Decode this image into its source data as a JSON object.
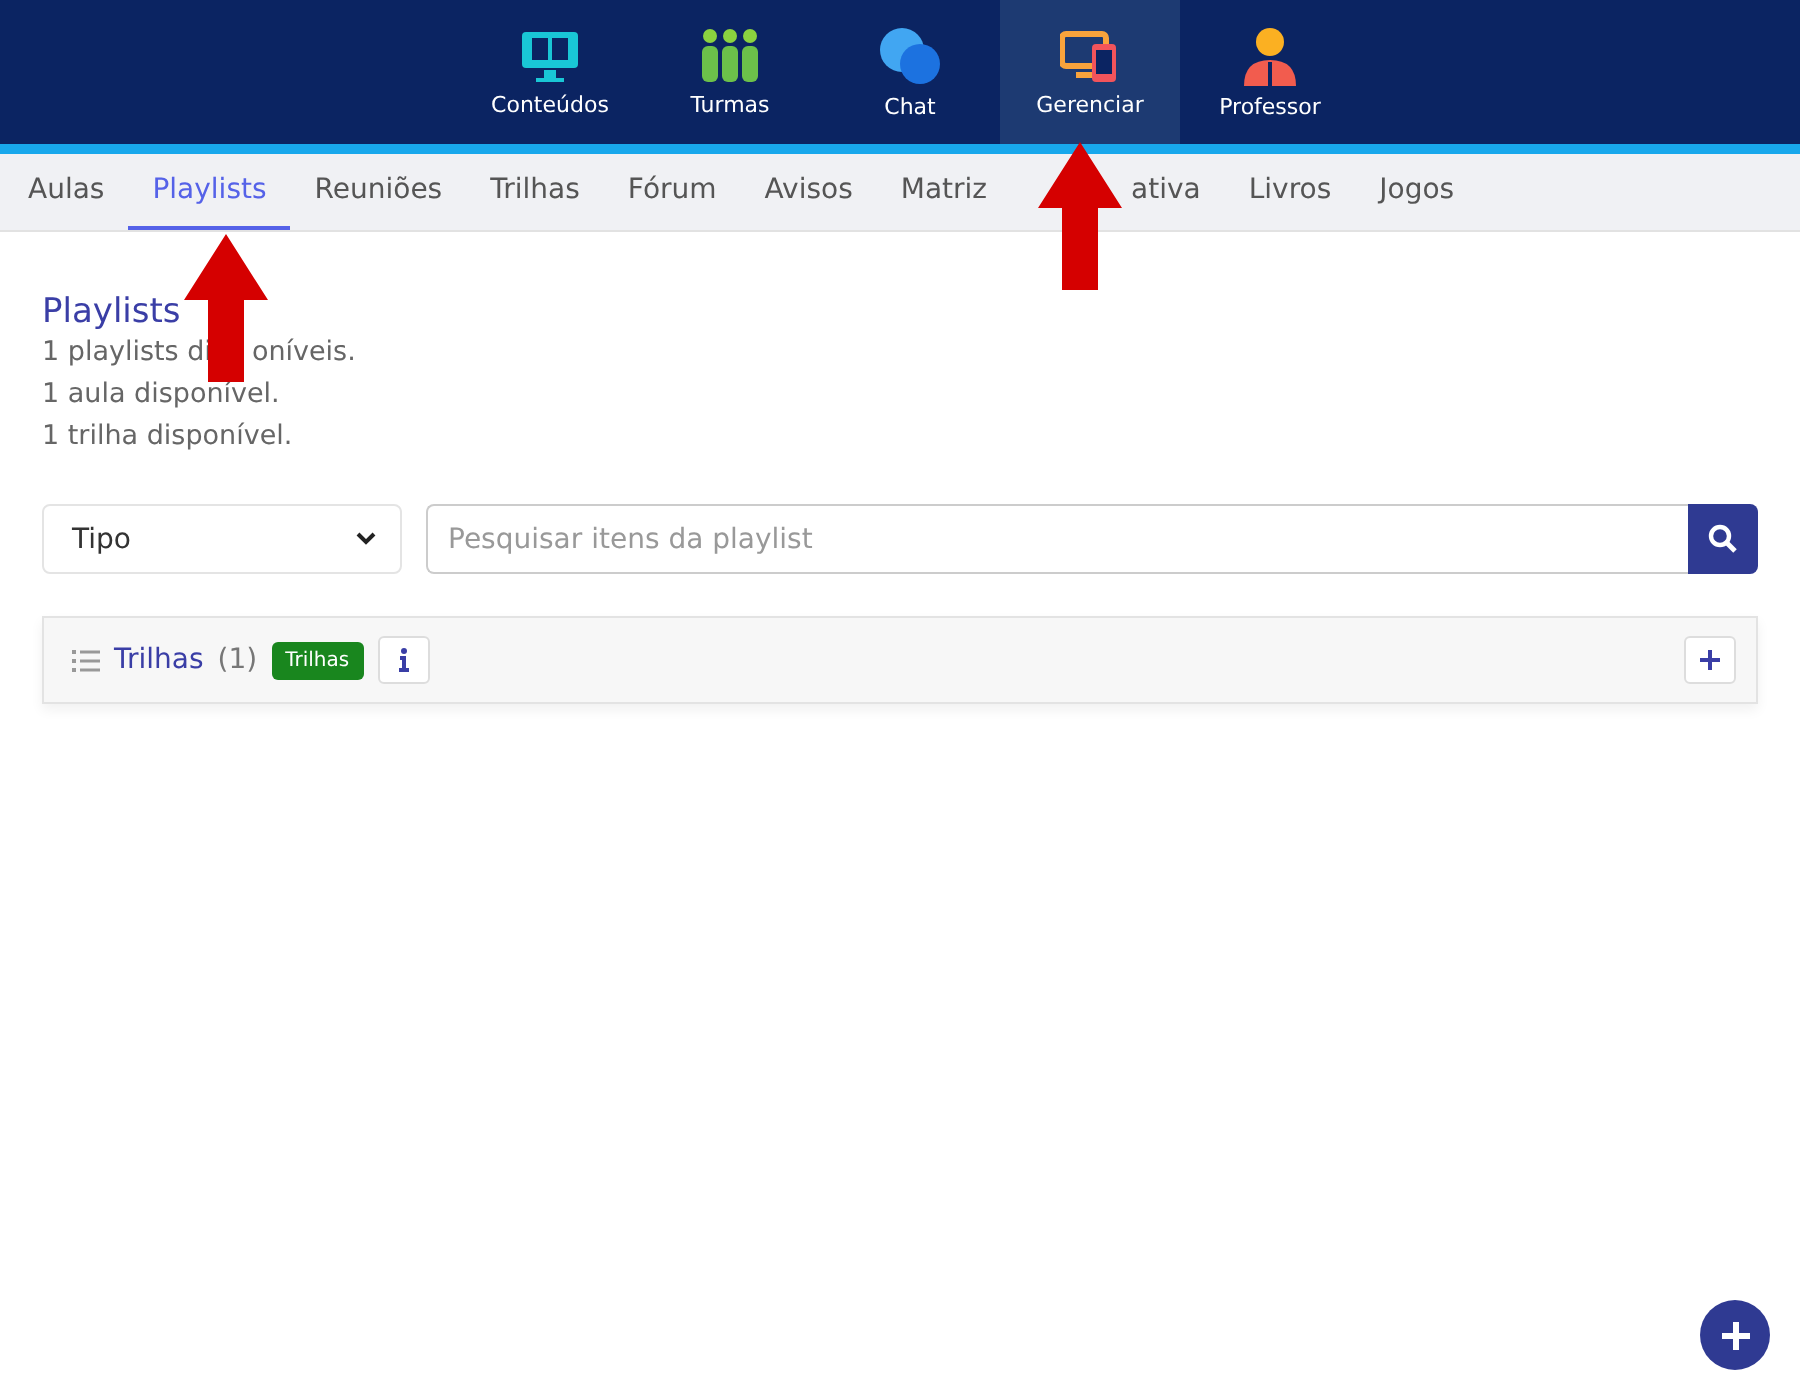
{
  "top_nav": [
    {
      "kind": "monitor",
      "label": "Conteúdos",
      "selected": false
    },
    {
      "kind": "people",
      "label": "Turmas",
      "selected": false
    },
    {
      "kind": "chat",
      "label": "Chat",
      "selected": false
    },
    {
      "kind": "devices",
      "label": "Gerenciar",
      "selected": true
    },
    {
      "kind": "person",
      "label": "Professor",
      "selected": false
    }
  ],
  "tabs": [
    {
      "parts": [
        "Aulas"
      ],
      "selected": false
    },
    {
      "parts": [
        "Playlists"
      ],
      "selected": true
    },
    {
      "parts": [
        "Reuniões"
      ],
      "selected": false
    },
    {
      "parts": [
        "Trilhas"
      ],
      "selected": false
    },
    {
      "parts": [
        "Fórum"
      ],
      "selected": false
    },
    {
      "parts": [
        "Avisos"
      ],
      "selected": false
    },
    {
      "parts": [
        "Matriz",
        "ativa"
      ],
      "selected": false
    },
    {
      "parts": [
        "Livros"
      ],
      "selected": false
    },
    {
      "parts": [
        "Jogos"
      ],
      "selected": false
    }
  ],
  "page": {
    "title": "Playlists",
    "lines": [
      [
        "1 playlists di",
        "oníveis."
      ],
      [
        "1 aula disponível."
      ],
      [
        "1 trilha disponível."
      ]
    ]
  },
  "filters": {
    "type_select": "Tipo",
    "search_placeholder": "Pesquisar itens da playlist"
  },
  "groups": [
    {
      "title": "Trilhas",
      "count": "(1)",
      "tag": "Trilhas"
    }
  ],
  "annotations": [
    {
      "kind": "arrow"
    },
    {
      "kind": "arrow"
    }
  ]
}
